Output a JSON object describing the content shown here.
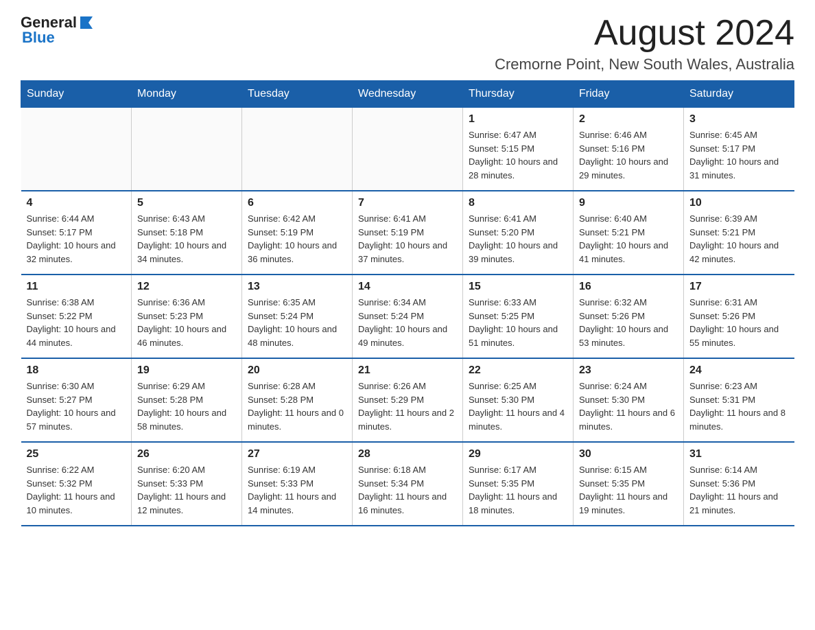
{
  "header": {
    "logo_general": "General",
    "logo_blue": "Blue",
    "title": "August 2024",
    "subtitle": "Cremorne Point, New South Wales, Australia"
  },
  "columns": [
    "Sunday",
    "Monday",
    "Tuesday",
    "Wednesday",
    "Thursday",
    "Friday",
    "Saturday"
  ],
  "weeks": [
    [
      {
        "day": "",
        "info": ""
      },
      {
        "day": "",
        "info": ""
      },
      {
        "day": "",
        "info": ""
      },
      {
        "day": "",
        "info": ""
      },
      {
        "day": "1",
        "info": "Sunrise: 6:47 AM\nSunset: 5:15 PM\nDaylight: 10 hours and 28 minutes."
      },
      {
        "day": "2",
        "info": "Sunrise: 6:46 AM\nSunset: 5:16 PM\nDaylight: 10 hours and 29 minutes."
      },
      {
        "day": "3",
        "info": "Sunrise: 6:45 AM\nSunset: 5:17 PM\nDaylight: 10 hours and 31 minutes."
      }
    ],
    [
      {
        "day": "4",
        "info": "Sunrise: 6:44 AM\nSunset: 5:17 PM\nDaylight: 10 hours and 32 minutes."
      },
      {
        "day": "5",
        "info": "Sunrise: 6:43 AM\nSunset: 5:18 PM\nDaylight: 10 hours and 34 minutes."
      },
      {
        "day": "6",
        "info": "Sunrise: 6:42 AM\nSunset: 5:19 PM\nDaylight: 10 hours and 36 minutes."
      },
      {
        "day": "7",
        "info": "Sunrise: 6:41 AM\nSunset: 5:19 PM\nDaylight: 10 hours and 37 minutes."
      },
      {
        "day": "8",
        "info": "Sunrise: 6:41 AM\nSunset: 5:20 PM\nDaylight: 10 hours and 39 minutes."
      },
      {
        "day": "9",
        "info": "Sunrise: 6:40 AM\nSunset: 5:21 PM\nDaylight: 10 hours and 41 minutes."
      },
      {
        "day": "10",
        "info": "Sunrise: 6:39 AM\nSunset: 5:21 PM\nDaylight: 10 hours and 42 minutes."
      }
    ],
    [
      {
        "day": "11",
        "info": "Sunrise: 6:38 AM\nSunset: 5:22 PM\nDaylight: 10 hours and 44 minutes."
      },
      {
        "day": "12",
        "info": "Sunrise: 6:36 AM\nSunset: 5:23 PM\nDaylight: 10 hours and 46 minutes."
      },
      {
        "day": "13",
        "info": "Sunrise: 6:35 AM\nSunset: 5:24 PM\nDaylight: 10 hours and 48 minutes."
      },
      {
        "day": "14",
        "info": "Sunrise: 6:34 AM\nSunset: 5:24 PM\nDaylight: 10 hours and 49 minutes."
      },
      {
        "day": "15",
        "info": "Sunrise: 6:33 AM\nSunset: 5:25 PM\nDaylight: 10 hours and 51 minutes."
      },
      {
        "day": "16",
        "info": "Sunrise: 6:32 AM\nSunset: 5:26 PM\nDaylight: 10 hours and 53 minutes."
      },
      {
        "day": "17",
        "info": "Sunrise: 6:31 AM\nSunset: 5:26 PM\nDaylight: 10 hours and 55 minutes."
      }
    ],
    [
      {
        "day": "18",
        "info": "Sunrise: 6:30 AM\nSunset: 5:27 PM\nDaylight: 10 hours and 57 minutes."
      },
      {
        "day": "19",
        "info": "Sunrise: 6:29 AM\nSunset: 5:28 PM\nDaylight: 10 hours and 58 minutes."
      },
      {
        "day": "20",
        "info": "Sunrise: 6:28 AM\nSunset: 5:28 PM\nDaylight: 11 hours and 0 minutes."
      },
      {
        "day": "21",
        "info": "Sunrise: 6:26 AM\nSunset: 5:29 PM\nDaylight: 11 hours and 2 minutes."
      },
      {
        "day": "22",
        "info": "Sunrise: 6:25 AM\nSunset: 5:30 PM\nDaylight: 11 hours and 4 minutes."
      },
      {
        "day": "23",
        "info": "Sunrise: 6:24 AM\nSunset: 5:30 PM\nDaylight: 11 hours and 6 minutes."
      },
      {
        "day": "24",
        "info": "Sunrise: 6:23 AM\nSunset: 5:31 PM\nDaylight: 11 hours and 8 minutes."
      }
    ],
    [
      {
        "day": "25",
        "info": "Sunrise: 6:22 AM\nSunset: 5:32 PM\nDaylight: 11 hours and 10 minutes."
      },
      {
        "day": "26",
        "info": "Sunrise: 6:20 AM\nSunset: 5:33 PM\nDaylight: 11 hours and 12 minutes."
      },
      {
        "day": "27",
        "info": "Sunrise: 6:19 AM\nSunset: 5:33 PM\nDaylight: 11 hours and 14 minutes."
      },
      {
        "day": "28",
        "info": "Sunrise: 6:18 AM\nSunset: 5:34 PM\nDaylight: 11 hours and 16 minutes."
      },
      {
        "day": "29",
        "info": "Sunrise: 6:17 AM\nSunset: 5:35 PM\nDaylight: 11 hours and 18 minutes."
      },
      {
        "day": "30",
        "info": "Sunrise: 6:15 AM\nSunset: 5:35 PM\nDaylight: 11 hours and 19 minutes."
      },
      {
        "day": "31",
        "info": "Sunrise: 6:14 AM\nSunset: 5:36 PM\nDaylight: 11 hours and 21 minutes."
      }
    ]
  ]
}
